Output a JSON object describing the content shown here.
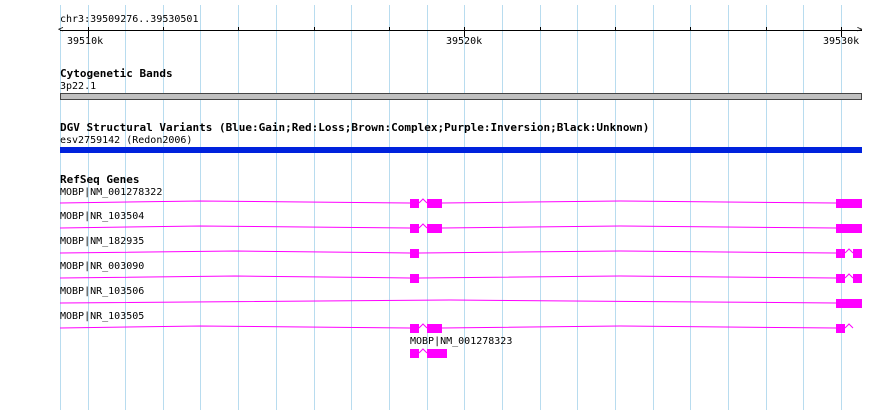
{
  "ruler": {
    "coords_label": "chr3:39509276..39530501",
    "ticks": [
      "39510k",
      "39520k",
      "39530k"
    ]
  },
  "tracks": {
    "cytoband": {
      "title": "Cytogenetic Bands",
      "band_label": "3p22.1",
      "color": "#c0c0c0"
    },
    "dgv": {
      "title": "DGV Structural Variants (Blue:Gain;Red:Loss;Brown:Complex;Purple:Inversion;Black:Unknown)",
      "feature_label": "esv2759142 (Redon2006)",
      "color": "#0022dd"
    },
    "refseq": {
      "title": "RefSeq Genes",
      "color": "#ff00ff",
      "genes": [
        "MOBP|NM_001278322",
        "MOBP|NR_103504",
        "MOBP|NM_182935",
        "MOBP|NR_003090",
        "MOBP|NR_103506",
        "MOBP|NR_103505",
        "MOBP|NM_001278323"
      ]
    }
  },
  "colors": {
    "grid": "#b8dcef",
    "gene": "#ff00ff"
  }
}
